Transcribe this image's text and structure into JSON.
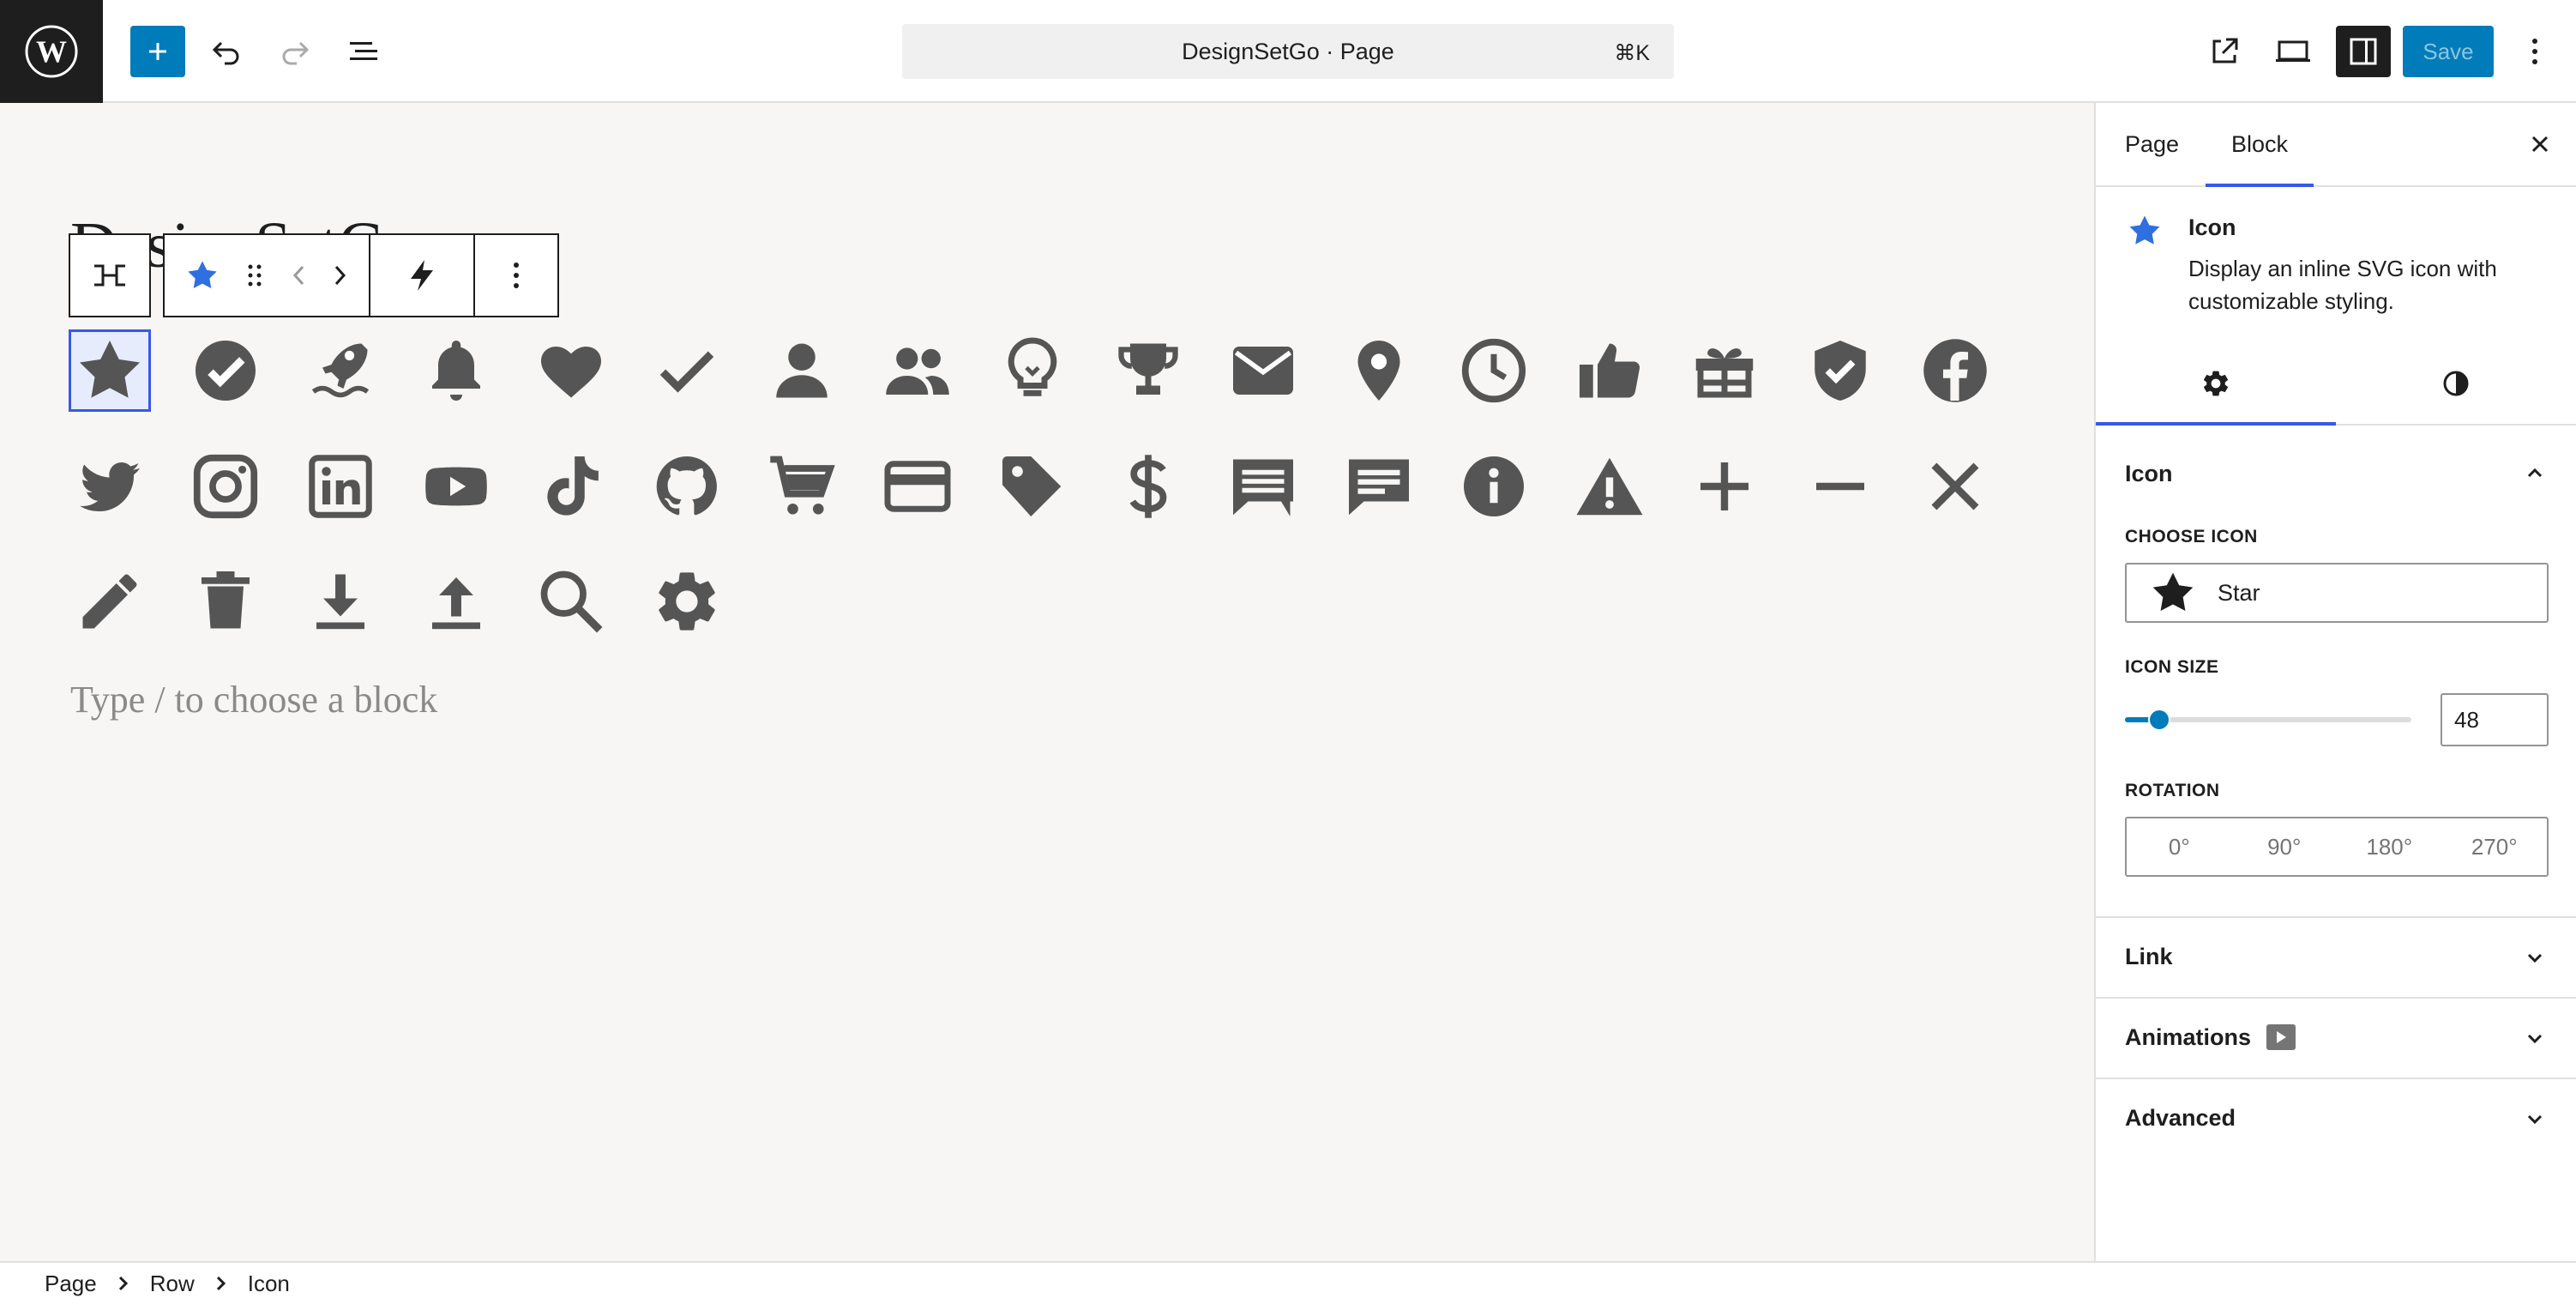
{
  "topbar": {
    "document_title": "DesignSetGo · Page",
    "shortcut": "⌘K",
    "save_label": "Save"
  },
  "canvas": {
    "page_title": "DesignSetGo",
    "block_hint": "Type / to choose a block",
    "icons": [
      "star",
      "check-circle",
      "rocket",
      "bell",
      "heart",
      "check",
      "user",
      "users",
      "lightbulb",
      "trophy",
      "envelope",
      "map-pin",
      "clock",
      "thumbs-up",
      "gift",
      "shield-check",
      "facebook",
      "twitter",
      "instagram",
      "linkedin",
      "youtube",
      "tiktok",
      "github",
      "shopping-cart",
      "credit-card",
      "tag",
      "dollar",
      "comment",
      "comment-alt",
      "info",
      "warning",
      "plus",
      "minus",
      "close",
      "pencil",
      "trash",
      "download",
      "upload",
      "search",
      "cog"
    ],
    "selected_icon": "star"
  },
  "sidebar": {
    "tabs": [
      "Page",
      "Block"
    ],
    "active_tab": "Block",
    "block": {
      "name": "Icon",
      "description": "Display an inline SVG icon with customizable styling."
    },
    "icon_panel": {
      "title": "Icon",
      "choose_label": "CHOOSE ICON",
      "choose_value": "Star",
      "size_label": "ICON SIZE",
      "size_value": "48",
      "size_slider_fraction": 0.12,
      "rotation_label": "ROTATION",
      "rotation_options": [
        "0°",
        "90°",
        "180°",
        "270°"
      ]
    },
    "panels": {
      "link": "Link",
      "animations": "Animations",
      "advanced": "Advanced"
    }
  },
  "breadcrumb": [
    "Page",
    "Row",
    "Icon"
  ],
  "colors": {
    "accent": "#007cba",
    "selection": "#3858e9",
    "star_blue": "#2f6fe0",
    "canvas_bg": "#f7f6f4",
    "icon_fill": "#555555"
  }
}
